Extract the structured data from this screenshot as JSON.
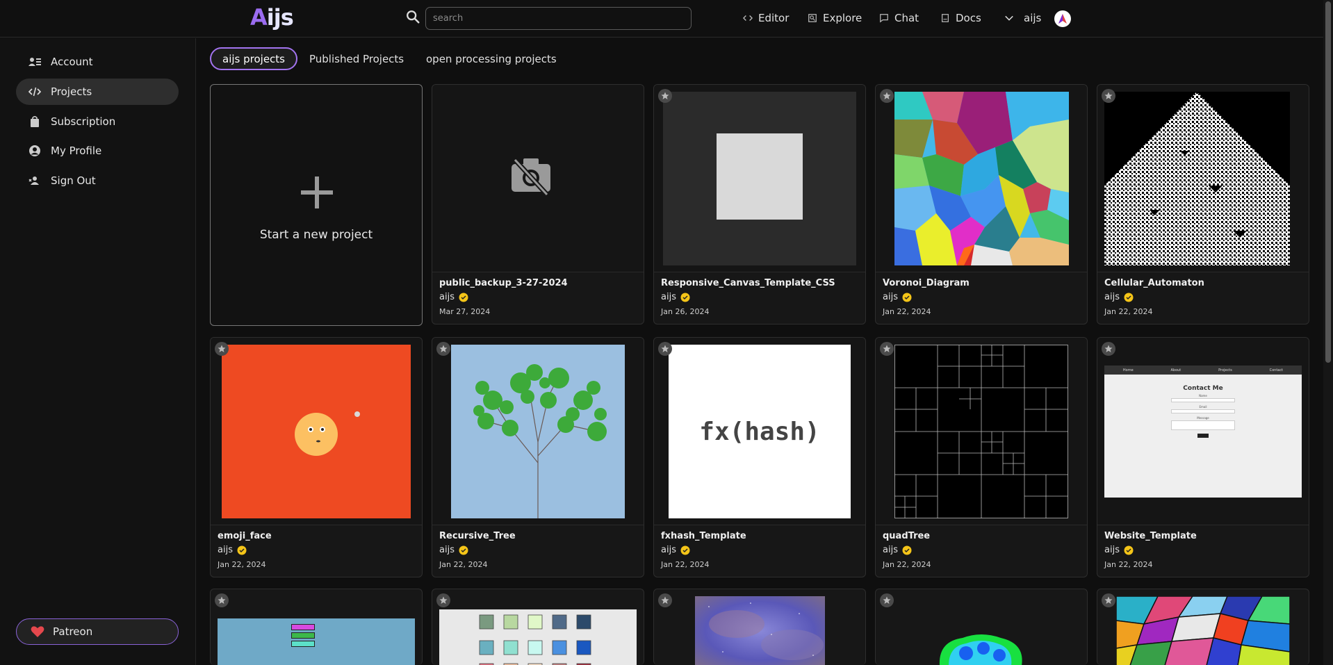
{
  "header": {
    "logo_first": "A",
    "logo_rest": "ijs",
    "search_placeholder": "search",
    "nav": [
      {
        "label": "Editor",
        "icon": "code-icon"
      },
      {
        "label": "Explore",
        "icon": "explore-icon"
      },
      {
        "label": "Chat",
        "icon": "chat-icon"
      },
      {
        "label": "Docs",
        "icon": "docs-icon"
      }
    ],
    "user": "aijs"
  },
  "sidebar": {
    "items": [
      {
        "label": "Account",
        "icon": "account-icon"
      },
      {
        "label": "Projects",
        "icon": "code-icon",
        "active": true
      },
      {
        "label": "Subscription",
        "icon": "bag-icon"
      },
      {
        "label": "My Profile",
        "icon": "profile-icon"
      },
      {
        "label": "Sign Out",
        "icon": "sign-out-icon"
      }
    ],
    "patreon": "Patreon"
  },
  "tabs": [
    {
      "label": "aijs projects",
      "active": true
    },
    {
      "label": "Published Projects"
    },
    {
      "label": "open processing projects"
    }
  ],
  "new_project": "Start a new project",
  "projects": [
    {
      "title": "public_backup_3-27-2024",
      "author": "aijs",
      "date": "Mar 27, 2024",
      "thumb": "no-image"
    },
    {
      "title": "Responsive_Canvas_Template_CSS",
      "author": "aijs",
      "date": "Jan 26, 2024",
      "thumb": "gray-square"
    },
    {
      "title": "Voronoi_Diagram",
      "author": "aijs",
      "date": "Jan 22, 2024",
      "thumb": "voronoi"
    },
    {
      "title": "Cellular_Automaton",
      "author": "aijs",
      "date": "Jan 22, 2024",
      "thumb": "automaton"
    },
    {
      "title": "emoji_face",
      "author": "aijs",
      "date": "Jan 22, 2024",
      "thumb": "emoji"
    },
    {
      "title": "Recursive_Tree",
      "author": "aijs",
      "date": "Jan 22, 2024",
      "thumb": "tree"
    },
    {
      "title": "fxhash_Template",
      "author": "aijs",
      "date": "Jan 22, 2024",
      "thumb": "fxhash",
      "thumb_text": "fx(hash)"
    },
    {
      "title": "quadTree",
      "author": "aijs",
      "date": "Jan 22, 2024",
      "thumb": "quadtree"
    },
    {
      "title": "Website_Template",
      "author": "aijs",
      "date": "Jan 22, 2024",
      "thumb": "website"
    },
    {
      "title": "",
      "author": "",
      "date": "",
      "thumb": "bars"
    },
    {
      "title": "",
      "author": "",
      "date": "",
      "thumb": "swatches"
    },
    {
      "title": "",
      "author": "",
      "date": "",
      "thumb": "nebula"
    },
    {
      "title": "",
      "author": "",
      "date": "",
      "thumb": "blob"
    },
    {
      "title": "",
      "author": "",
      "date": "",
      "thumb": "shards"
    }
  ],
  "website_thumb": {
    "nav": [
      "Home",
      "About",
      "Projects",
      "Contact"
    ],
    "heading": "Contact Me",
    "fields": [
      "Name",
      "Email",
      "Message"
    ]
  },
  "colors": {
    "accent": "#a374f0",
    "verified": "#f5c518",
    "patreon_heart": "#e5484d"
  }
}
